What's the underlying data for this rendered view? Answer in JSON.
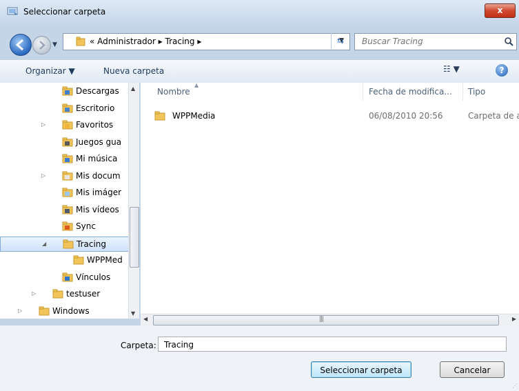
{
  "window": {
    "title": "Seleccionar carpeta",
    "close_label": "x"
  },
  "address": {
    "crumbs": "« Administrador  ▸  Tracing  ▸"
  },
  "search": {
    "placeholder": "Buscar Tracing"
  },
  "toolbar": {
    "organize_label": "Organizar ▼",
    "new_folder_label": "Nueva carpeta",
    "views_label": "☷ ▼",
    "help_label": "?"
  },
  "tree": {
    "items": [
      {
        "label": "Descargas",
        "icon": "downloads-folder-icon",
        "expander": ""
      },
      {
        "label": "Escritorio",
        "icon": "desktop-folder-icon",
        "expander": ""
      },
      {
        "label": "Favoritos",
        "icon": "favorites-folder-icon",
        "expander": "▷"
      },
      {
        "label": "Juegos gua",
        "icon": "saved-games-folder-icon",
        "expander": ""
      },
      {
        "label": "Mi música",
        "icon": "music-folder-icon",
        "expander": ""
      },
      {
        "label": "Mis docum",
        "icon": "documents-folder-icon",
        "expander": "▷"
      },
      {
        "label": "Mis imáger",
        "icon": "pictures-folder-icon",
        "expander": ""
      },
      {
        "label": "Mis vídeos",
        "icon": "videos-folder-icon",
        "expander": ""
      },
      {
        "label": "Sync",
        "icon": "sync-folder-icon",
        "expander": ""
      },
      {
        "label": "Tracing",
        "icon": "folder-icon",
        "expander": "◢"
      },
      {
        "label": "WPPMed",
        "icon": "folder-icon",
        "expander": ""
      },
      {
        "label": "Vínculos",
        "icon": "links-folder-icon",
        "expander": ""
      },
      {
        "label": "testuser",
        "icon": "user-folder-icon",
        "expander": "▷"
      },
      {
        "label": "Windows",
        "icon": "folder-icon",
        "expander": "▷"
      }
    ]
  },
  "columns": {
    "name": "Nombre",
    "date": "Fecha de modifica...",
    "type": "Tipo"
  },
  "files": [
    {
      "name": "WPPMedia",
      "date": "06/08/2010 20:56",
      "type": "Carpeta de a"
    }
  ],
  "bottom": {
    "folder_label": "Carpeta:",
    "folder_value": "Tracing",
    "select_button": "Seleccionar carpeta",
    "cancel_button": "Cancelar"
  },
  "colors": {
    "selection": "#cfe3fb",
    "close_red": "#c23118"
  }
}
